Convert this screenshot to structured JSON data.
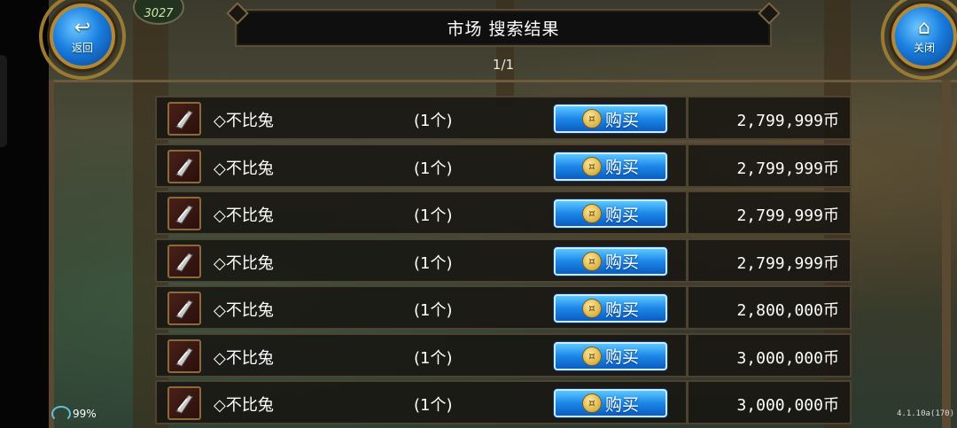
{
  "nav": {
    "back_label": "返回",
    "close_label": "关闭",
    "counter_text": "3027"
  },
  "header": {
    "title": "市场  搜索结果",
    "page": "1/1"
  },
  "listings": [
    {
      "name": "◇不比兔",
      "qty": "(1个)",
      "buy_label": "购买",
      "price": "2,799,999币"
    },
    {
      "name": "◇不比兔",
      "qty": "(1个)",
      "buy_label": "购买",
      "price": "2,799,999币"
    },
    {
      "name": "◇不比兔",
      "qty": "(1个)",
      "buy_label": "购买",
      "price": "2,799,999币"
    },
    {
      "name": "◇不比兔",
      "qty": "(1个)",
      "buy_label": "购买",
      "price": "2,799,999币"
    },
    {
      "name": "◇不比兔",
      "qty": "(1个)",
      "buy_label": "购买",
      "price": "2,800,000币"
    },
    {
      "name": "◇不比兔",
      "qty": "(1个)",
      "buy_label": "购买",
      "price": "3,000,000币"
    },
    {
      "name": "◇不比兔",
      "qty": "(1个)",
      "buy_label": "购买",
      "price": "3,000,000币"
    }
  ],
  "status": {
    "battery": "99%",
    "version": "4.1.10a(170)"
  },
  "icons": {
    "back": "back-arrow-icon",
    "close": "home-icon",
    "item": "dagger-icon",
    "coin": "coin-icon"
  }
}
